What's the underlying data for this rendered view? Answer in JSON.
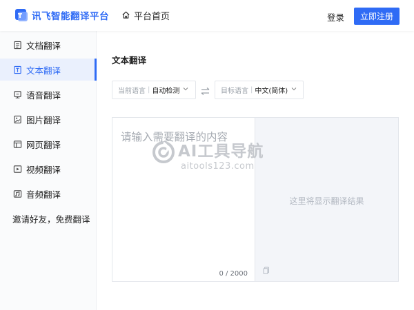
{
  "header": {
    "logo_text": "讯飞智能翻译平台",
    "home_label": "平台首页",
    "login_label": "登录",
    "register_label": "立即注册"
  },
  "sidebar": {
    "items": [
      {
        "label": "文档翻译",
        "icon": "document-icon",
        "active": false
      },
      {
        "label": "文本翻译",
        "icon": "text-icon",
        "active": true
      },
      {
        "label": "语音翻译",
        "icon": "microphone-icon",
        "active": false
      },
      {
        "label": "图片翻译",
        "icon": "image-icon",
        "active": false
      },
      {
        "label": "网页翻译",
        "icon": "webpage-icon",
        "active": false
      },
      {
        "label": "视频翻译",
        "icon": "video-icon",
        "active": false
      },
      {
        "label": "音频翻译",
        "icon": "audio-icon",
        "active": false
      }
    ],
    "invite_text": "邀请好友，免费翻译"
  },
  "main": {
    "title": "文本翻译",
    "source_lang": {
      "label": "当前语言",
      "separator": "|",
      "value": "自动检测"
    },
    "target_lang": {
      "label": "目标语言",
      "separator": "|",
      "value": "中文(简体)"
    },
    "input_placeholder": "请输入需要翻译的内容",
    "char_count": "0 / 2000",
    "output_hint": "这里将显示翻译结果"
  },
  "watermark": {
    "title": "AI工具导航",
    "subtitle": "aitools123.com"
  },
  "colors": {
    "accent": "#2f6bf5",
    "active_bg": "#eaf0fd",
    "output_bg": "#f3f5f9"
  }
}
